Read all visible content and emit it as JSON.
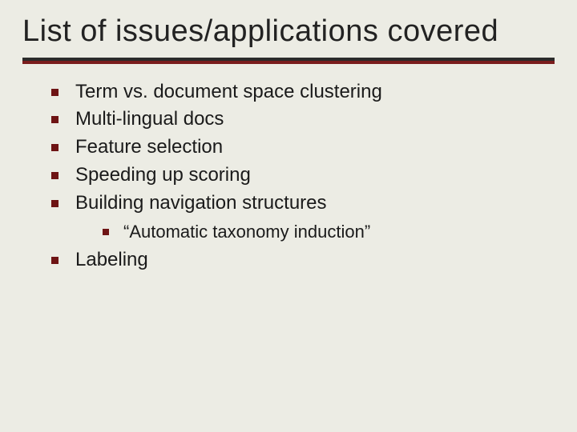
{
  "title": "List of issues/applications covered",
  "bullets": {
    "b0": "Term vs. document space clustering",
    "b1": "Multi-lingual docs",
    "b2": "Feature selection",
    "b3": "Speeding up scoring",
    "b4": "Building navigation structures",
    "b4_sub0": "“Automatic taxonomy induction”",
    "b5": "Labeling"
  }
}
